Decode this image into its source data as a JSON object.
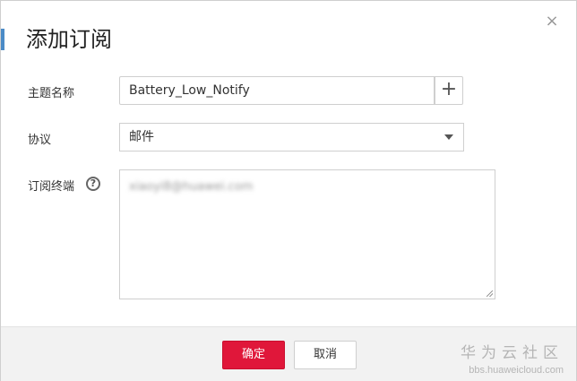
{
  "dialog": {
    "title": "添加订阅",
    "close_glyph": "×"
  },
  "form": {
    "topic_name": {
      "label": "主题名称",
      "value": "Battery_Low_Notify",
      "add_glyph": "+"
    },
    "protocol": {
      "label": "协议",
      "selected": "邮件"
    },
    "endpoint": {
      "label": "订阅终端",
      "help_glyph": "?",
      "value": "xiaoyi8@huawei.com"
    }
  },
  "footer": {
    "confirm_label": "确定",
    "cancel_label": "取消"
  },
  "watermark": {
    "title": "华为云社区",
    "url": "bbs.huaweicloud.com"
  },
  "colors": {
    "accent_bar": "#4b8bc7",
    "confirm_button": "#e0173a",
    "footer_bg": "#f2f2f2"
  },
  "icons": {
    "close": "close-icon",
    "add": "plus-icon",
    "dropdown": "chevron-down-icon",
    "help": "help-circle-icon"
  }
}
